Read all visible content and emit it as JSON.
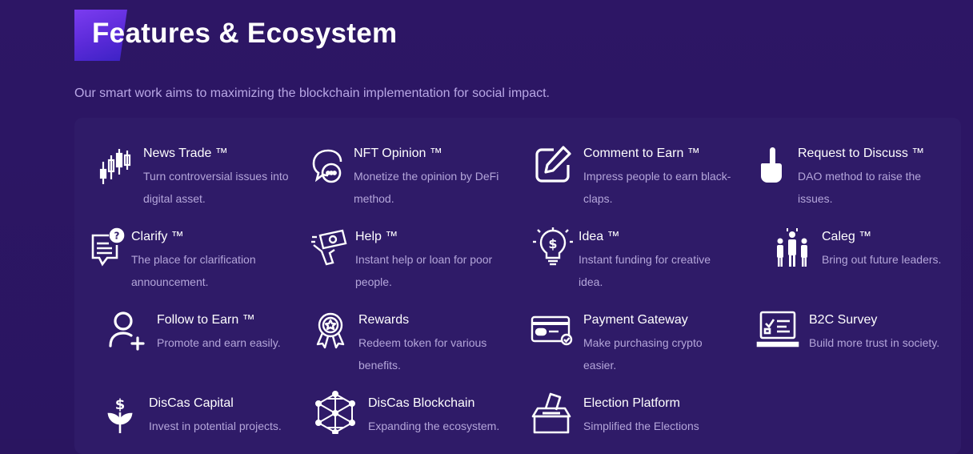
{
  "header": {
    "title": "Features & Ecosystem",
    "subtitle": "Our smart work aims to maximizing the blockchain implementation for social impact."
  },
  "colors": {
    "background": "#2a1560",
    "panel": "#2f1b68",
    "accent": "#6a32e6",
    "desc": "#b4a6da"
  },
  "features": [
    {
      "title": "News Trade ™",
      "desc": "Turn controversial issues into digital asset.",
      "icon": "candlestick-chart-icon"
    },
    {
      "title": "NFT Opinion ™",
      "desc": "Monetize the opinion by DeFi method.",
      "icon": "chat-bubbles-icon"
    },
    {
      "title": "Comment to Earn ™",
      "desc": "Impress people to earn black-claps.",
      "icon": "edit-pen-icon"
    },
    {
      "title": "Request to Discuss ™",
      "desc": "DAO method to raise the issues.",
      "icon": "raised-finger-icon"
    },
    {
      "title": "Clarify ™",
      "desc": "The place for clarification announcement.",
      "icon": "question-document-icon"
    },
    {
      "title": "Help ™",
      "desc": "Instant help or loan for poor people.",
      "icon": "money-hand-icon"
    },
    {
      "title": "Idea ™",
      "desc": "Instant funding for creative idea.",
      "icon": "lightbulb-dollar-icon"
    },
    {
      "title": "Caleg ™",
      "desc": "Bring out future leaders.",
      "icon": "leaders-podium-icon"
    },
    {
      "title": "Follow to Earn ™",
      "desc": "Promote and earn easily.",
      "icon": "user-add-icon"
    },
    {
      "title": "Rewards",
      "desc": "Redeem token for various benefits.",
      "icon": "award-badge-icon"
    },
    {
      "title": "Payment Gateway",
      "desc": "Make purchasing crypto easier.",
      "icon": "credit-card-icon"
    },
    {
      "title": "B2C Survey",
      "desc": "Build more trust in society.",
      "icon": "laptop-survey-icon"
    },
    {
      "title": "DisCas Capital",
      "desc": "Invest in potential projects.",
      "icon": "money-plant-icon"
    },
    {
      "title": "DisCas Blockchain",
      "desc": "Expanding the ecosystem.",
      "icon": "blockchain-cube-icon"
    },
    {
      "title": "Election Platform",
      "desc": "Simplified the Elections",
      "icon": "ballot-box-icon"
    }
  ]
}
